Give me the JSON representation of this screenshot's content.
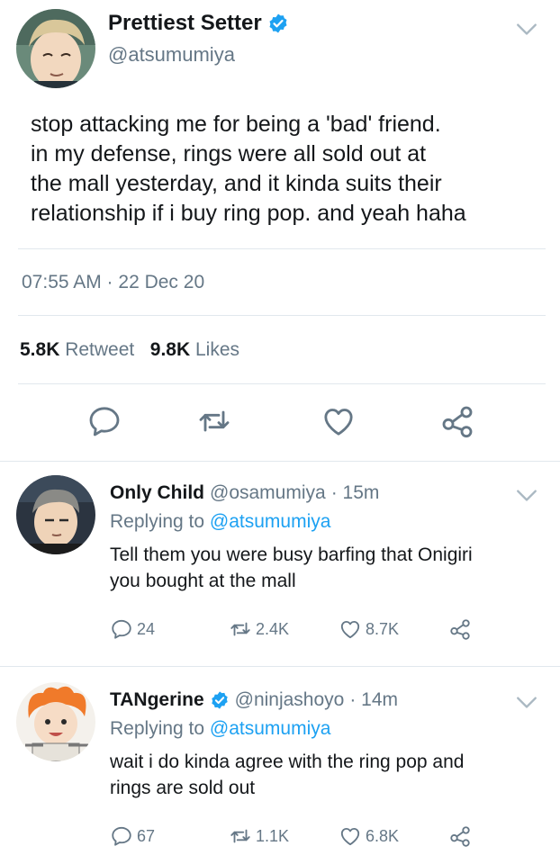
{
  "main_tweet": {
    "display_name": "Prettiest Setter",
    "handle": "@atsumumiya",
    "verified": true,
    "text_lines": [
      "stop attacking me for being a 'bad' friend.",
      "in my defense, rings were all sold out at",
      "the mall yesterday, and it kinda suits their",
      "relationship if i buy ring pop. and yeah haha"
    ],
    "timestamp": "07:55 AM · 22 Dec 20",
    "retweets_count": "5.8K",
    "retweets_label": "Retweet",
    "likes_count": "9.8K",
    "likes_label": "Likes"
  },
  "replies": [
    {
      "display_name": "Only Child",
      "handle": "@osamumiya",
      "time": "· 15m",
      "verified": false,
      "replying_prefix": "Replying to",
      "replying_to": "@atsumumiya",
      "text_lines": [
        "Tell them you were busy barfing that Onigiri",
        "you bought at the mall"
      ],
      "reply_count": "24",
      "retweet_count": "2.4K",
      "like_count": "8.7K"
    },
    {
      "display_name": "TANgerine",
      "handle": "@ninjashoyo",
      "time": "· 14m",
      "verified": true,
      "replying_prefix": "Replying to",
      "replying_to": "@atsumumiya",
      "text_lines": [
        "wait i do kinda agree with the ring pop and",
        "rings are sold out"
      ],
      "reply_count": "67",
      "retweet_count": "1.1K",
      "like_count": "6.8K"
    }
  ],
  "colors": {
    "accent": "#1da1f2",
    "secondary_text": "#657786",
    "primary_text": "#14171a",
    "divider": "#e1e8ed"
  },
  "icons": [
    "verified-badge-icon",
    "chevron-down-icon",
    "reply-icon",
    "retweet-icon",
    "like-icon",
    "share-icon"
  ]
}
